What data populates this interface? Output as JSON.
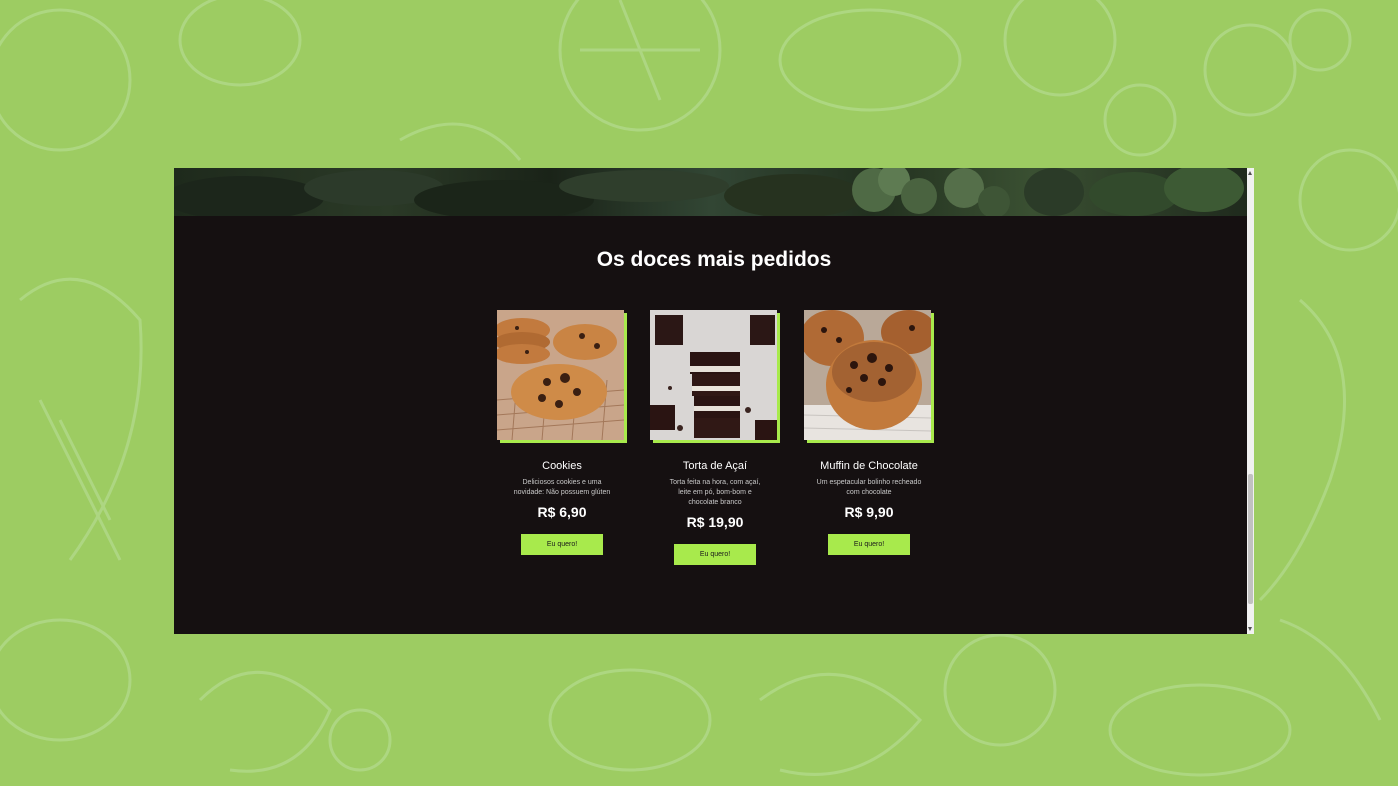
{
  "section": {
    "title": "Os doces mais pedidos"
  },
  "products": [
    {
      "name": "Cookies",
      "description": "Deliciosos cookies e uma novidade: Não possuem glúten",
      "price": "R$ 6,90",
      "button_label": "Eu quero!",
      "image": "cookies-photo"
    },
    {
      "name": "Torta de Açaí",
      "description": "Torta feita na hora, com açaí, leite em pó, bom-bom e chocolate branco",
      "price": "R$ 19,90",
      "button_label": "Eu quero!",
      "image": "acai-pie-photo"
    },
    {
      "name": "Muffin de Chocolate",
      "description": "Um espetacular bolinho recheado com chocolate",
      "price": "R$ 9,90",
      "button_label": "Eu quero!",
      "image": "chocolate-muffin-photo"
    }
  ],
  "colors": {
    "page_background": "#9dcc62",
    "panel_background": "#151011",
    "accent": "#a8ea4c",
    "text": "#ffffff"
  }
}
